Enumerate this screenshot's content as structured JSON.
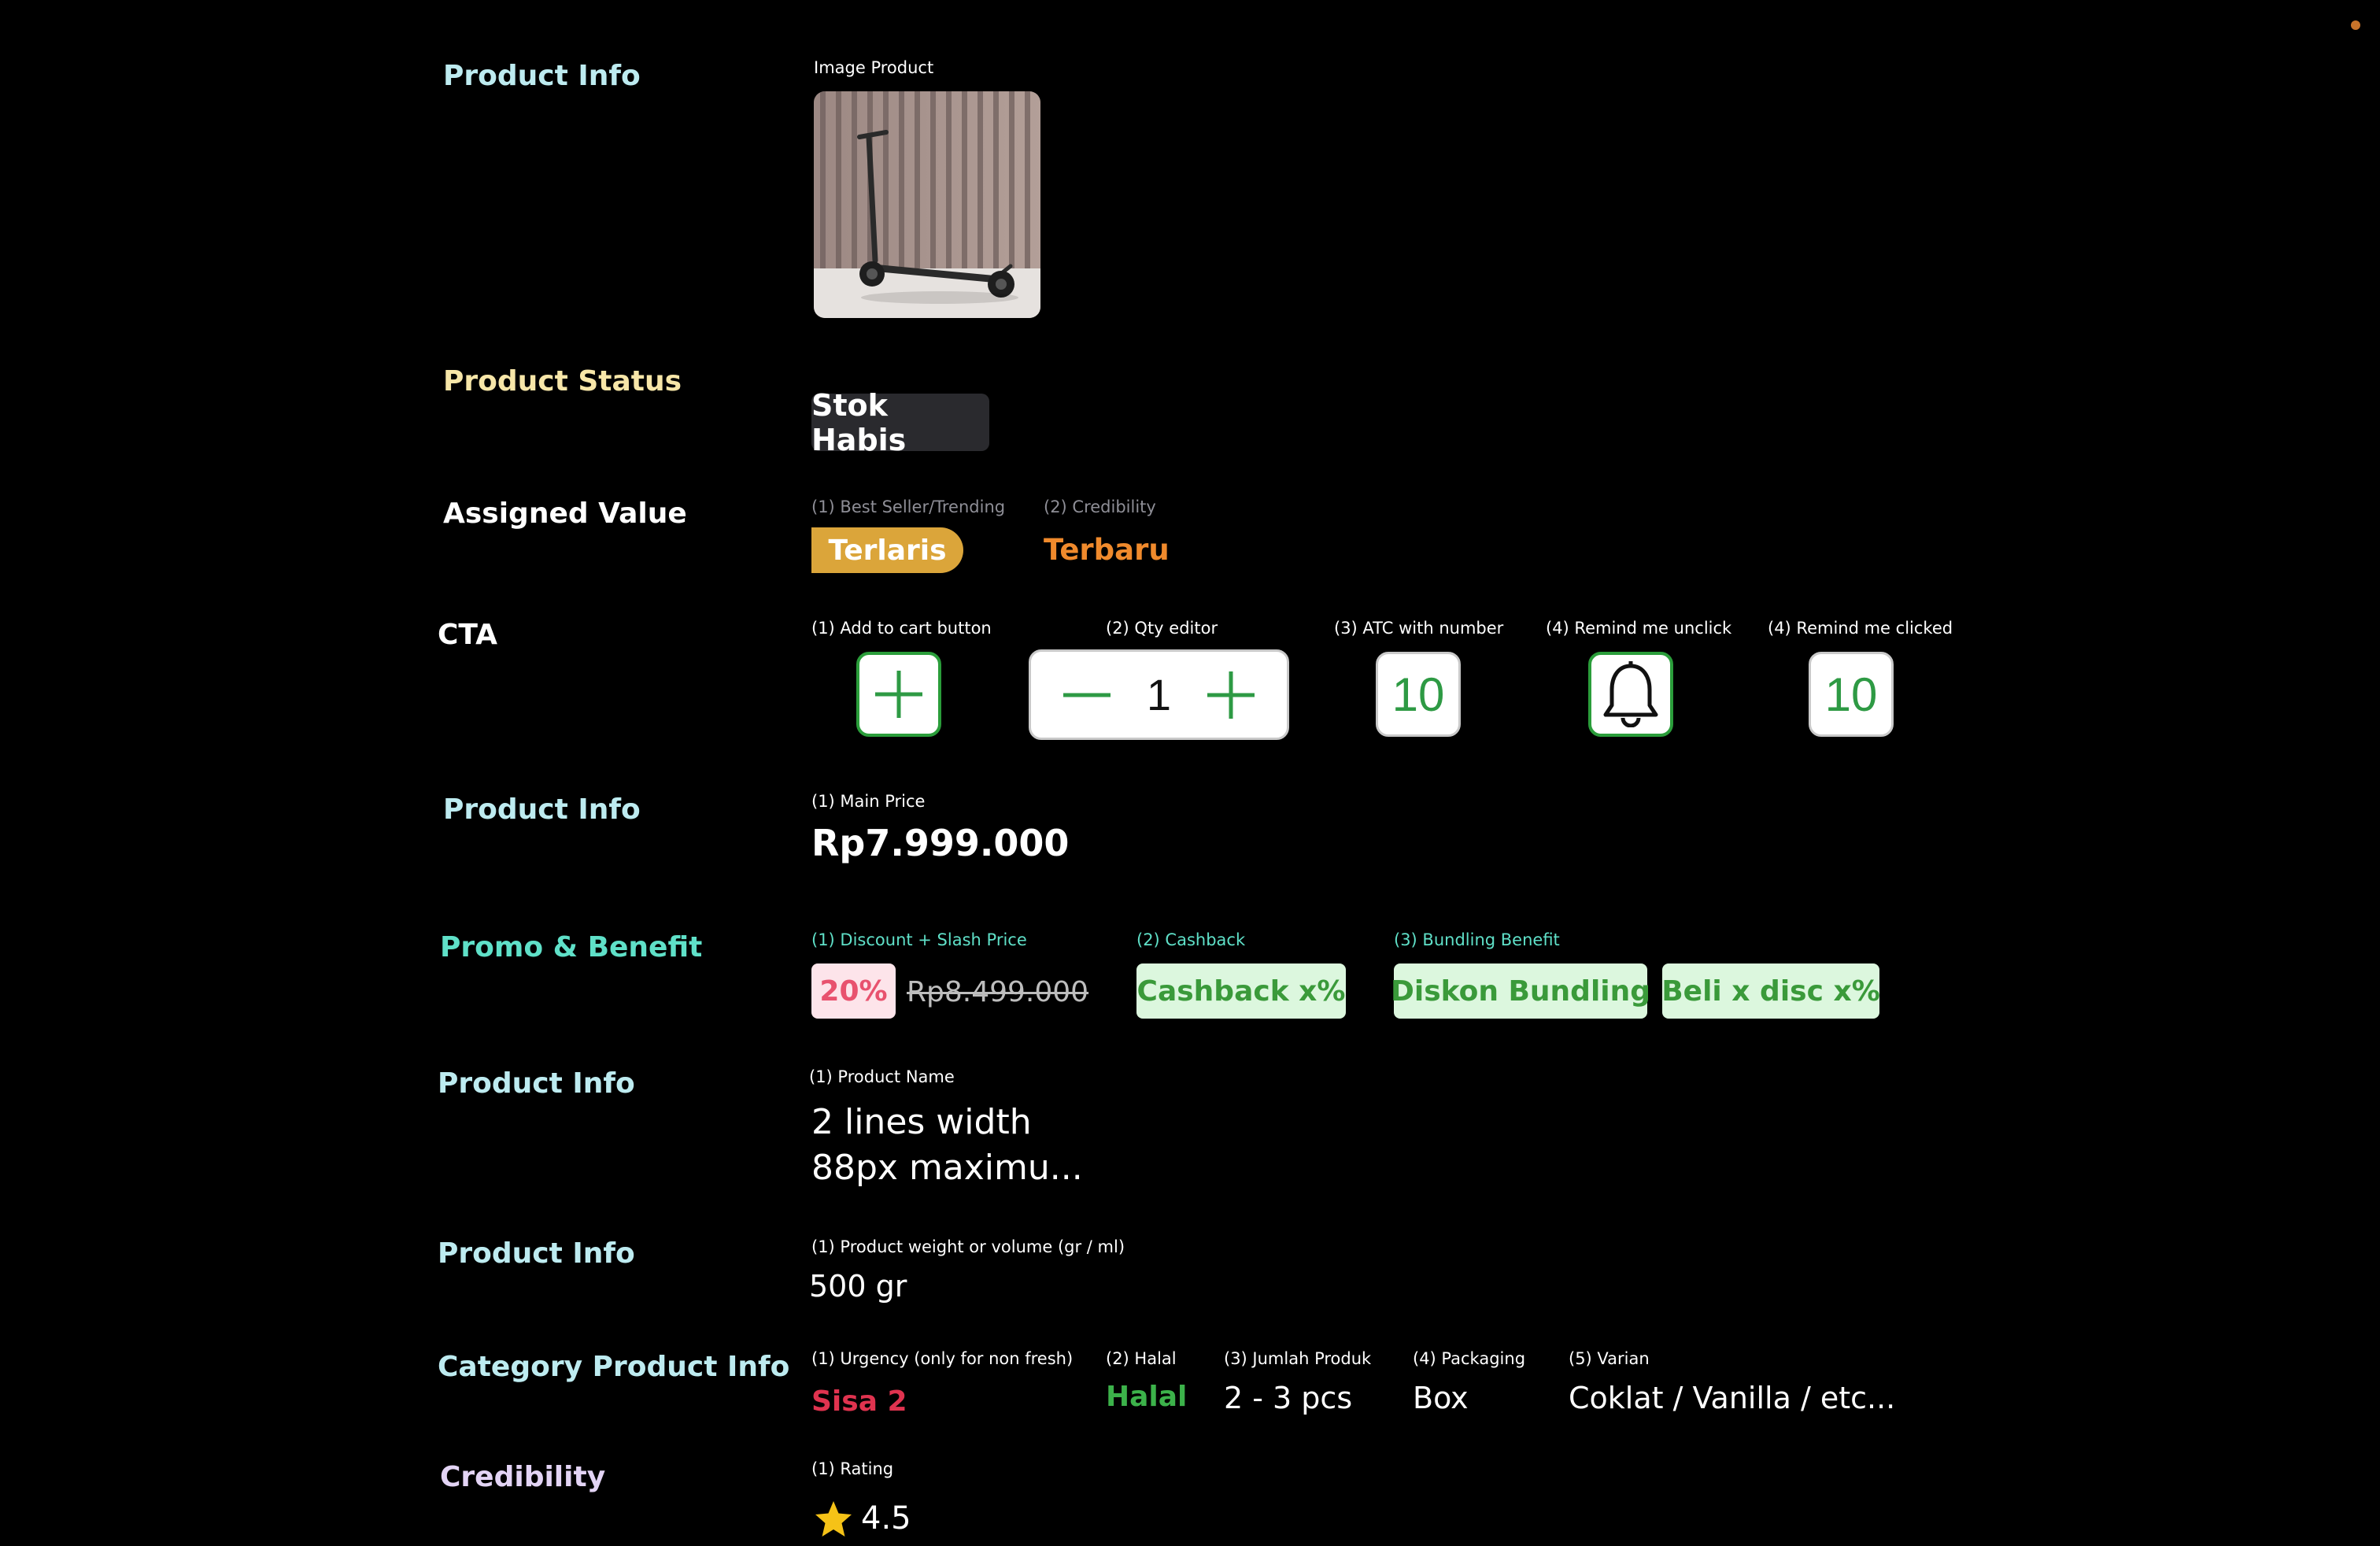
{
  "colors": {
    "background": "#000000",
    "teal_title": "#bdebf0",
    "yellow_title": "#f7e6a8",
    "mint_title": "#5fe0c8",
    "lavender_title": "#e3d4f5",
    "gold": "#dba53a",
    "orange": "#f08a2c",
    "green": "#2e9a44",
    "red": "#e0334f",
    "star": "#f5c217"
  },
  "sections": {
    "product_info_image": {
      "title": "Product Info",
      "label": "Image Product"
    },
    "product_status": {
      "title": "Product Status",
      "badge": "Stok Habis"
    },
    "assigned_value": {
      "title": "Assigned Value",
      "label_1": "(1) Best Seller/Trending",
      "value_1": "Terlaris",
      "label_2": "(2) Credibility",
      "value_2": "Terbaru"
    },
    "cta": {
      "title": "CTA",
      "label_1": "(1) Add to cart button",
      "label_2": "(2) Qty editor",
      "qty_value": "1",
      "label_3": "(3) ATC with number",
      "atc_number": "10",
      "label_4": "(4) Remind me unclick",
      "label_5": "(4) Remind me clicked",
      "remind_number": "10",
      "icons": {
        "add": "plus-icon",
        "minus": "minus-icon",
        "bell": "bell-icon"
      }
    },
    "product_info_price": {
      "title": "Product Info",
      "label": "(1) Main Price",
      "price": "Rp7.999.000"
    },
    "promo": {
      "title": "Promo & Benefit",
      "label_1": "(1) Discount + Slash Price",
      "discount": "20%",
      "slash_price": "Rp8.499.000",
      "label_2": "(2) Cashback",
      "cashback": "Cashback x%",
      "label_3": "(3) Bundling Benefit",
      "bundling_1": "Diskon Bundling",
      "bundling_2": "Beli x disc x%"
    },
    "product_info_name": {
      "title": "Product Info",
      "label": "(1) Product Name",
      "line_1": "2 lines width",
      "line_2": "88px maximu..."
    },
    "product_info_weight": {
      "title": "Product Info",
      "label": "(1) Product weight or volume (gr / ml)",
      "value": "500 gr"
    },
    "category": {
      "title": "Category Product Info",
      "label_1": "(1) Urgency (only for non fresh)",
      "value_1": "Sisa 2",
      "label_2": "(2) Halal",
      "value_2": "Halal",
      "label_3": "(3) Jumlah Produk",
      "value_3": "2 - 3 pcs",
      "label_4": "(4) Packaging",
      "value_4": "Box",
      "label_5": "(5) Varian",
      "value_5": "Coklat / Vanilla / etc..."
    },
    "credibility": {
      "title": "Credibility",
      "label": "(1) Rating",
      "rating": "4.5",
      "icon": "star-icon"
    }
  }
}
